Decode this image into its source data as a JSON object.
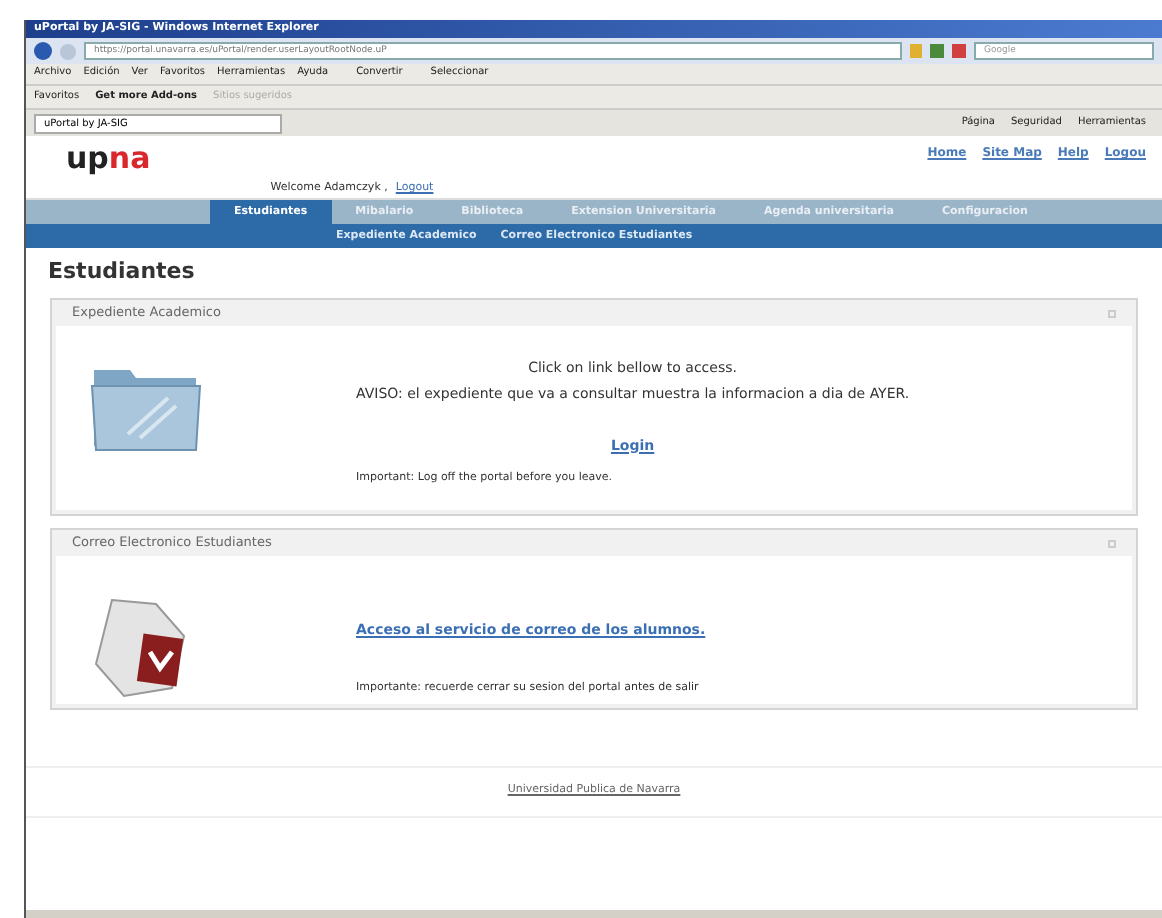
{
  "window": {
    "title": "uPortal by JA-SIG - Windows Internet Explorer"
  },
  "address_bar": {
    "value": "https://portal.unavarra.es/uPortal/render.userLayoutRootNode.uP",
    "search_placeholder": "Google"
  },
  "menu_bar": [
    "Archivo",
    "Edición",
    "Ver",
    "Favoritos",
    "Herramientas",
    "Ayuda"
  ],
  "toolbar": [
    "Convertir",
    "Seleccionar"
  ],
  "favorites_bar": {
    "favorites": "Favoritos",
    "addons": "Get more Add-ons",
    "suggested": "Sitios sugeridos"
  },
  "browser_tab": {
    "title": "uPortal by JA-SIG"
  },
  "command_bar": [
    "Página",
    "Seguridad",
    "Herramientas"
  ],
  "header": {
    "logo_main": "up",
    "logo_accent": "na",
    "top_links": [
      "Home",
      "Site Map",
      "Help",
      "Logou"
    ],
    "welcome": "Welcome Adamczyk ,",
    "logout": "Logout"
  },
  "nav_tabs": [
    {
      "label": "Estudiantes",
      "selected": true
    },
    {
      "label": "Mibalario",
      "selected": false
    },
    {
      "label": "Biblioteca",
      "selected": false
    },
    {
      "label": "Extension Universitaria",
      "selected": false
    },
    {
      "label": "Agenda universitaria",
      "selected": false
    },
    {
      "label": "Configuracion",
      "selected": false
    }
  ],
  "sub_nav": [
    "Expediente Academico",
    "Correo Electronico Estudiantes"
  ],
  "page_title": "Estudiantes",
  "channels": [
    {
      "kind": "folder",
      "title": "Expediente Academico",
      "lines": [
        {
          "kind": "text",
          "text": "Click on link bellow to access."
        },
        {
          "kind": "text",
          "text": "AVISO: el expediente que va a consultar muestra la informacion a dia de AYER."
        },
        {
          "kind": "link",
          "text": "Login"
        },
        {
          "kind": "small",
          "text": "Important: Log off the portal before you leave."
        }
      ]
    },
    {
      "kind": "mail",
      "title": "Correo Electronico Estudiantes",
      "lines": [
        {
          "kind": "link",
          "text": "Acceso al servicio de correo de los alumnos."
        },
        {
          "kind": "small",
          "text": "Importante: recuerde cerrar su sesion del portal antes de salir"
        }
      ]
    }
  ],
  "footer": {
    "link": "Universidad Publica de Navarra"
  }
}
